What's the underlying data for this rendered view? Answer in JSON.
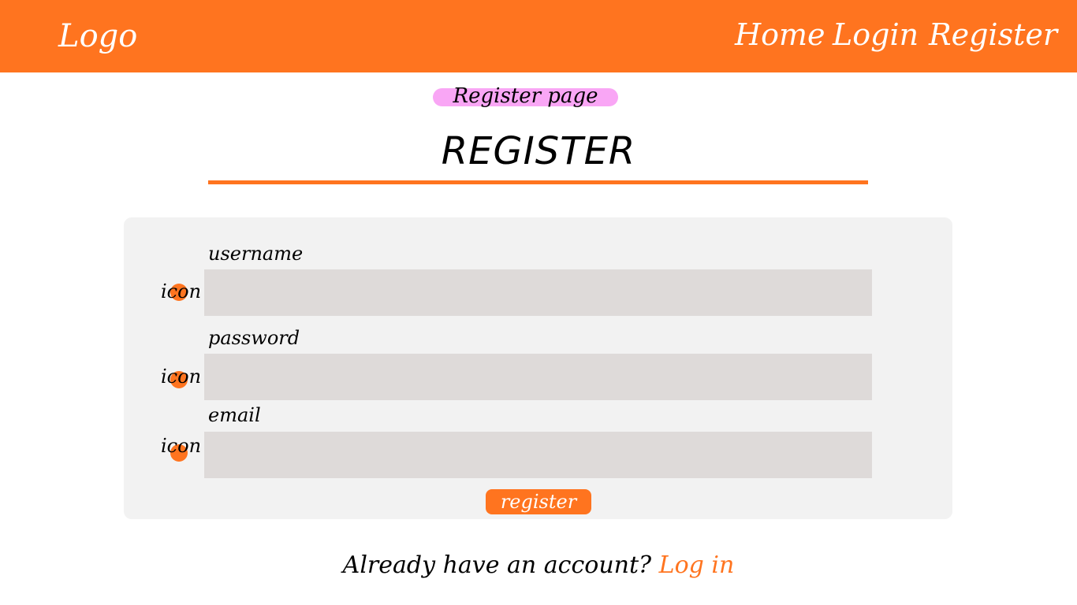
{
  "colors": {
    "accent": "#ff741f",
    "tag_bg": "#f9a6f5",
    "card_bg": "#f2f2f2",
    "input_bg": "#dedad9"
  },
  "header": {
    "logo": "Logo",
    "nav": {
      "home": "Home",
      "login": "Login",
      "register": "Register"
    }
  },
  "page_tag": "Register page",
  "title": "REGISTER",
  "form": {
    "fields": [
      {
        "label": "username",
        "icon_label": "icon",
        "icon": "user-icon",
        "value": ""
      },
      {
        "label": "password",
        "icon_label": "icon",
        "icon": "lock-icon",
        "value": ""
      },
      {
        "label": "email",
        "icon_label": "icon",
        "icon": "mail-icon",
        "value": ""
      }
    ],
    "submit_label": "register"
  },
  "footer": {
    "prompt": "Already have an account?",
    "link": "Log in"
  }
}
